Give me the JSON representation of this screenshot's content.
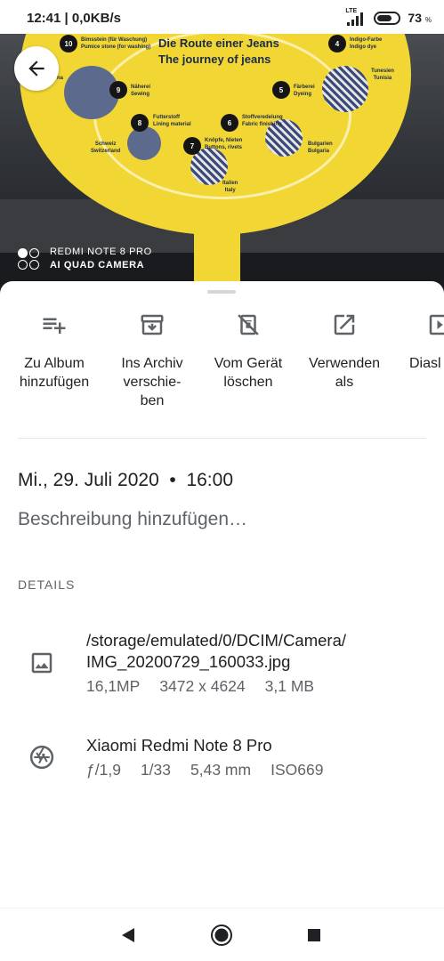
{
  "status_bar": {
    "time": "12:41",
    "speed": "0,0KB/s",
    "network": "LTE",
    "battery_percent": "73",
    "battery_symbol": "%",
    "battery_level": 0.73,
    "icons": [
      "lte-signal-icon",
      "battery-icon"
    ]
  },
  "photo": {
    "headline_de": "Die Route einer Jeans",
    "headline_en": "The journey of jeans",
    "back_icon": "arrow-left-icon",
    "watermark": {
      "line1": "REDMI NOTE 8 PRO",
      "line2": "AI QUAD CAMERA"
    },
    "stops": [
      {
        "num": "10",
        "label": "Bimsstein (für Waschung)\nPumice stone (for washing)"
      },
      {
        "num": "4",
        "label": "Indigo-Farbe\nIndigo dye"
      },
      {
        "num": "9",
        "label": "Näherei\nSewing"
      },
      {
        "num": "5",
        "label": "Färberei\nDyeing"
      },
      {
        "num": "8",
        "label": "Futterstoff\nLining material"
      },
      {
        "num": "6",
        "label": "Stoffveredelung\nFabric finishing"
      },
      {
        "num": "7",
        "label": "Knöpfe, Nieten\nButtons, rivets"
      }
    ],
    "countries": [
      {
        "label": "Tunesien\nTunisia"
      },
      {
        "label": "Schweiz\nSwitzerland"
      },
      {
        "label": "Bulgarien\nBulgaria"
      },
      {
        "label": "Italien\nItaly"
      },
      {
        "label": "na"
      }
    ]
  },
  "actions": [
    {
      "label": "Zu Album\nhinzufügen",
      "icon": "playlist-add-icon"
    },
    {
      "label": "Ins Archiv\nverschie-\nben",
      "icon": "archive-icon"
    },
    {
      "label": "Vom Gerät\nlöschen",
      "icon": "delete-from-device-icon"
    },
    {
      "label": "Verwenden\nals",
      "icon": "open-in-new-icon"
    },
    {
      "label": "Diasl",
      "icon": "slideshow-icon"
    }
  ],
  "datetime": "Mi., 29. Juli 2020  •  16:00",
  "description_placeholder": "Beschreibung hinzufügen…",
  "details_title": "DETAILS",
  "file": {
    "icon": "image-icon",
    "path_line1": "/storage/emulated/0/DCIM/Camera/",
    "path_line2": "IMG_20200729_160033.jpg",
    "megapixels": "16,1MP",
    "resolution": "3472 x 4624",
    "size": "3,1 MB"
  },
  "camera": {
    "icon": "camera-aperture-icon",
    "model": "Xiaomi Redmi Note 8 Pro",
    "aperture": "ƒ/1,9",
    "shutter": "1/33",
    "focal": "5,43 mm",
    "iso": "ISO669"
  },
  "navbar": {
    "icons": [
      "back-triangle-icon",
      "home-circle-icon",
      "recents-square-icon"
    ]
  },
  "colors": {
    "text_primary": "#202124",
    "text_secondary": "#5f6368",
    "icon": "#5f6368",
    "poster_yellow": "#f2d734"
  }
}
